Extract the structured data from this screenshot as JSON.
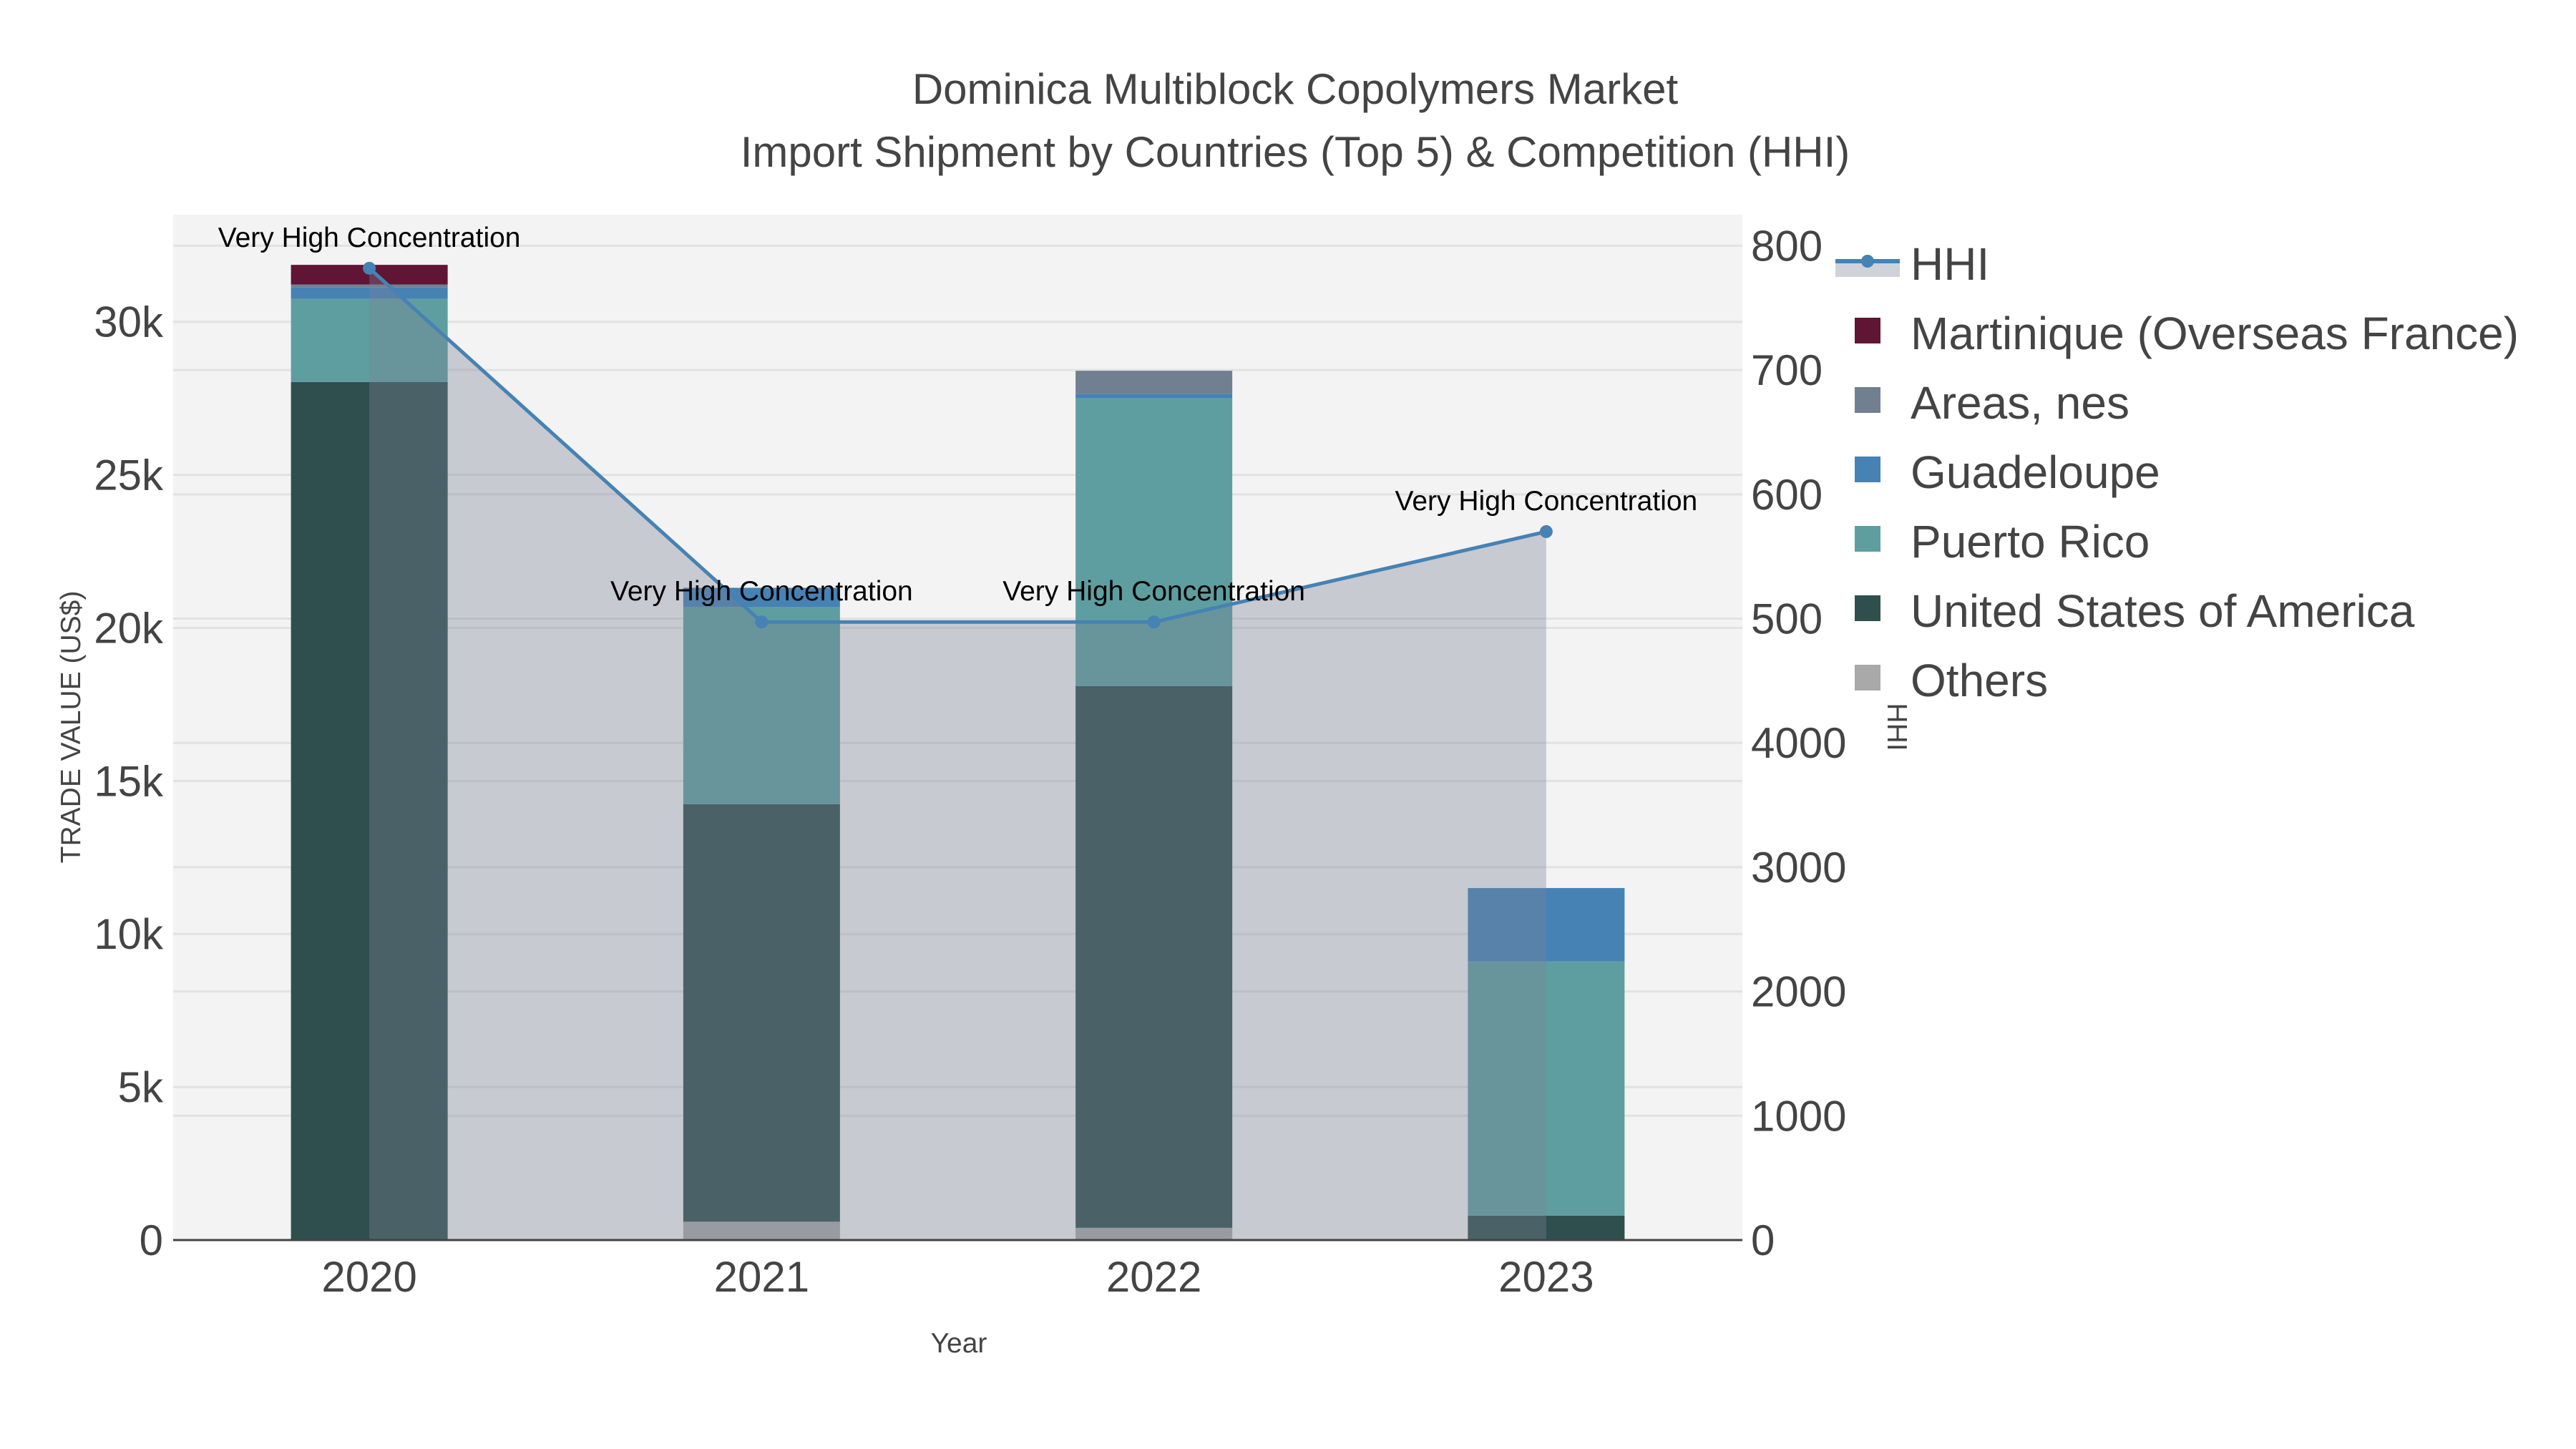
{
  "chart_data": {
    "type": "bar",
    "title": "Dominica Multiblock Copolymers Market",
    "subtitle": "Import Shipment by Countries (Top 5) & Competition (HHI)",
    "xlabel": "Year",
    "ylabel": "TRADE VALUE (US$)",
    "y2label": "HHI",
    "categories": [
      "2020",
      "2021",
      "2022",
      "2023"
    ],
    "ylim": [
      0,
      33500
    ],
    "y2lim": [
      0,
      8250
    ],
    "yticks": [
      {
        "v": 0,
        "label": "0"
      },
      {
        "v": 5000,
        "label": "5k"
      },
      {
        "v": 10000,
        "label": "10k"
      },
      {
        "v": 15000,
        "label": "15k"
      },
      {
        "v": 20000,
        "label": "20k"
      },
      {
        "v": 25000,
        "label": "25k"
      },
      {
        "v": 30000,
        "label": "30k"
      }
    ],
    "y2ticks": [
      {
        "v": 0,
        "label": "0"
      },
      {
        "v": 1000,
        "label": "1000"
      },
      {
        "v": 2000,
        "label": "2000"
      },
      {
        "v": 3000,
        "label": "3000"
      },
      {
        "v": 4000,
        "label": "4000"
      },
      {
        "v": 5000,
        "label": "500"
      },
      {
        "v": 6000,
        "label": "600"
      },
      {
        "v": 7000,
        "label": "700"
      },
      {
        "v": 8000,
        "label": "800"
      }
    ],
    "series": [
      {
        "name": "Others",
        "color": "#a9a9a9",
        "values": [
          0,
          600,
          400,
          0
        ]
      },
      {
        "name": "United States of America",
        "color": "#2f4f4f",
        "values": [
          28030,
          13640,
          17700,
          800
        ]
      },
      {
        "name": "Puerto Rico",
        "color": "#5f9ea0",
        "values": [
          2720,
          6440,
          9400,
          8300
        ]
      },
      {
        "name": "Guadeloupe",
        "color": "#4682b4",
        "values": [
          370,
          630,
          150,
          2400
        ]
      },
      {
        "name": "Areas, nes",
        "color": "#708090",
        "values": [
          100,
          0,
          750,
          0
        ]
      },
      {
        "name": "Martinique (Overseas France)",
        "color": "#601535",
        "values": [
          640,
          0,
          0,
          0
        ]
      }
    ],
    "hhi": {
      "name": "HHI",
      "color": "#4682b4",
      "values": [
        7819,
        4973,
        4973,
        5700
      ]
    },
    "annotations": [
      "Very High Concentration",
      "Very High Concentration",
      "Very High Concentration",
      "Very High Concentration"
    ],
    "legend": [
      "HHI",
      "Martinique (Overseas France)",
      "Areas, nes",
      "Guadeloupe",
      "Puerto Rico",
      "United States of America",
      "Others"
    ],
    "legend_position": "right",
    "grid": true
  }
}
